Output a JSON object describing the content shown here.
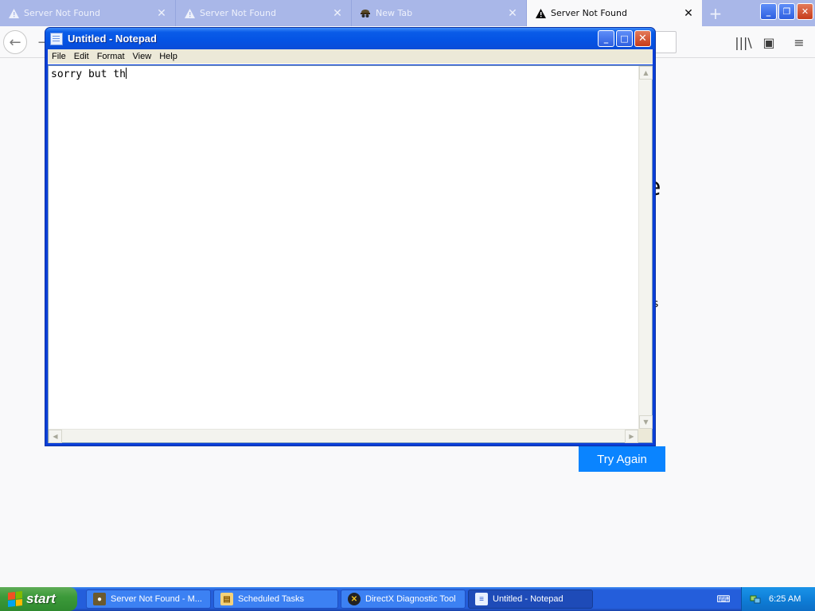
{
  "browser": {
    "tabs": [
      {
        "label": "Server Not Found",
        "icon": "warning-icon",
        "active": false
      },
      {
        "label": "Server Not Found",
        "icon": "warning-icon",
        "active": false
      },
      {
        "label": "New Tab",
        "icon": "spy-icon",
        "active": false
      },
      {
        "label": "Server Not Found",
        "icon": "warning-icon",
        "active": true
      }
    ],
    "new_tab_symbol": "+",
    "back_symbol": "←",
    "forward_symbol": "→",
    "library_symbol": "|||\\",
    "sidebar_symbol": "▣",
    "menu_symbol": "≡",
    "window_controls": {
      "minimize": "_",
      "restore": "❐",
      "close": "✕"
    },
    "page": {
      "partial_glyph_1": "e",
      "partial_glyph_2": "s",
      "try_again_label": "Try Again"
    }
  },
  "notepad": {
    "title": "Untitled - Notepad",
    "menu": [
      "File",
      "Edit",
      "Format",
      "View",
      "Help"
    ],
    "content": "sorry but th",
    "controls": {
      "minimize": "_",
      "maximize": "□",
      "close": "✕"
    }
  },
  "taskbar": {
    "start_label": "start",
    "tasks": [
      {
        "label": "Server Not Found - M...",
        "icon": "firefox-icon",
        "active": false
      },
      {
        "label": "Scheduled Tasks",
        "icon": "scheduled-tasks-icon",
        "active": false
      },
      {
        "label": "DirectX Diagnostic Tool",
        "icon": "directx-icon",
        "active": false
      },
      {
        "label": "Untitled - Notepad",
        "icon": "notepad-icon",
        "active": true
      }
    ],
    "clock": "6:25 AM"
  },
  "colors": {
    "tabbar": "#a9b7e8",
    "xp_blue": "#0453e4",
    "start_green": "#3c9a3a",
    "try_again_blue": "#0a84ff"
  }
}
